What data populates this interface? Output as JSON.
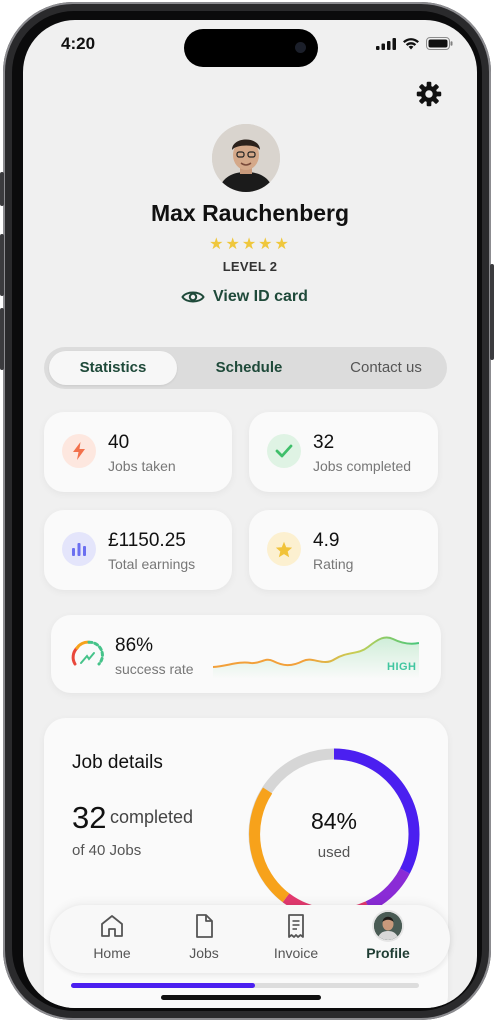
{
  "status_bar": {
    "time": "4:20"
  },
  "profile": {
    "name": "Max Rauchenberg",
    "rating_stars": 5,
    "stars_text": "★★★★★",
    "level": "LEVEL 2",
    "view_id_label": "View ID card"
  },
  "tabs": [
    {
      "label": "Statistics",
      "active": true
    },
    {
      "label": "Schedule",
      "active": false
    },
    {
      "label": "Contact us",
      "active": false
    }
  ],
  "stats": [
    {
      "value": "40",
      "label": "Jobs taken",
      "icon": "lightning-icon",
      "color": "#f2704b"
    },
    {
      "value": "32",
      "label": "Jobs completed",
      "icon": "check-icon",
      "color": "#3fbf6a"
    },
    {
      "value": "£1150.25",
      "label": "Total earnings",
      "icon": "bar-chart-icon",
      "color": "#6b6ff0"
    },
    {
      "value": "4.9",
      "label": "Rating",
      "icon": "star-icon",
      "color": "#f1c33a"
    }
  ],
  "success": {
    "value": "86%",
    "label": "success rate",
    "badge": "HIGH"
  },
  "job_details": {
    "title": "Job details",
    "completed": "32",
    "completed_suffix": "completed",
    "of_text": "of 40 Jobs",
    "used_percent": "84%",
    "used_label": "used"
  },
  "nav": [
    {
      "label": "Home",
      "icon": "home-icon",
      "active": false
    },
    {
      "label": "Jobs",
      "icon": "document-icon",
      "active": false
    },
    {
      "label": "Invoice",
      "icon": "receipt-icon",
      "active": false
    },
    {
      "label": "Profile",
      "icon": "avatar-icon",
      "active": true
    }
  ],
  "scroll_progress": 0.53,
  "colors": {
    "accent_dark_green": "#1f4a3a",
    "star_yellow": "#efc73c",
    "high_green": "#41c6a0",
    "progress_purple": "#4b1ff0",
    "donut_purple": "#4b1ff0",
    "donut_orange": "#f7a21b",
    "donut_pink": "#e33a6f",
    "donut_grey": "#d6d6d6"
  }
}
